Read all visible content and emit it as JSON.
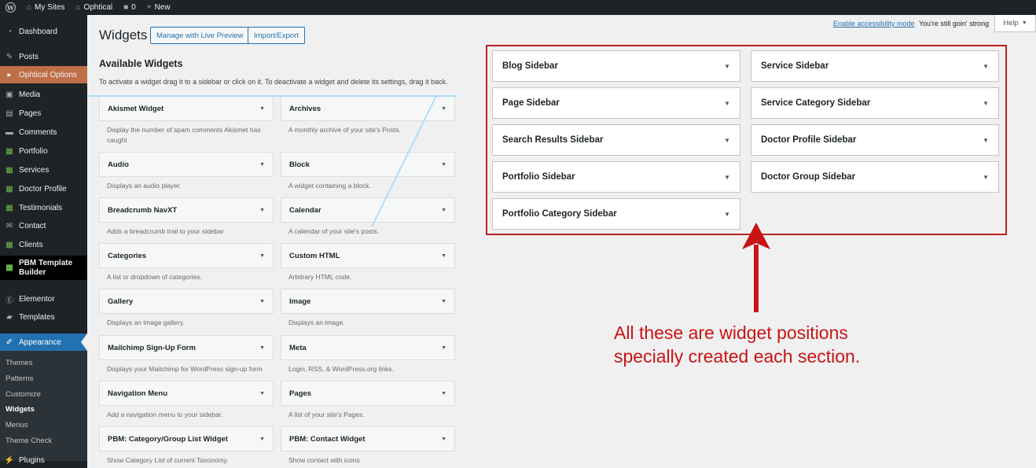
{
  "adminbar": {
    "my_sites": "My Sites",
    "site_name": "Ophtical",
    "comments_count": "0",
    "new_label": "New"
  },
  "menu": {
    "items": [
      {
        "label": "Dashboard",
        "icon": "dashboard-icon"
      },
      {
        "label": "Posts",
        "icon": "pin-icon"
      },
      {
        "label": "Ophtical Options",
        "icon": "caret-right-icon"
      },
      {
        "label": "Media",
        "icon": "media-icon"
      },
      {
        "label": "Pages",
        "icon": "page-icon"
      },
      {
        "label": "Comments",
        "icon": "comment-icon"
      },
      {
        "label": "Portfolio",
        "icon": "grid-icon"
      },
      {
        "label": "Services",
        "icon": "grid-icon"
      },
      {
        "label": "Doctor Profile",
        "icon": "grid-icon"
      },
      {
        "label": "Testimonials",
        "icon": "grid-icon"
      },
      {
        "label": "Contact",
        "icon": "mail-icon"
      },
      {
        "label": "Clients",
        "icon": "grid-icon"
      },
      {
        "label": "PBM Template Builder",
        "icon": "grid-icon"
      },
      {
        "label": "Elementor",
        "icon": "elementor-icon"
      },
      {
        "label": "Templates",
        "icon": "folder-icon"
      },
      {
        "label": "Appearance",
        "icon": "brush-icon"
      },
      {
        "label": "Plugins",
        "icon": "plugin-icon"
      }
    ],
    "submenu": [
      "Themes",
      "Patterns",
      "Customize",
      "Widgets",
      "Menus",
      "Theme Check"
    ]
  },
  "top": {
    "accessibility_link": "Enable accessibility mode",
    "status_text": "You're still goin' strong",
    "help_label": "Help"
  },
  "header": {
    "title": "Widgets",
    "live_preview_button": "Manage with Live Preview",
    "import_export_button": "Import/Export"
  },
  "available": {
    "title": "Available Widgets",
    "description": "To activate a widget drag it to a sidebar or click on it. To deactivate a widget and delete its settings, drag it back.",
    "widgets": [
      {
        "name": "Akismet Widget",
        "desc": "Display the number of spam comments Akismet has caught"
      },
      {
        "name": "Archives",
        "desc": "A monthly archive of your site's Posts."
      },
      {
        "name": "Audio",
        "desc": "Displays an audio player."
      },
      {
        "name": "Block",
        "desc": "A widget containing a block."
      },
      {
        "name": "Breadcrumb NavXT",
        "desc": "Adds a breadcrumb trail to your sidebar"
      },
      {
        "name": "Calendar",
        "desc": "A calendar of your site's posts."
      },
      {
        "name": "Categories",
        "desc": "A list or dropdown of categories."
      },
      {
        "name": "Custom HTML",
        "desc": "Arbitrary HTML code."
      },
      {
        "name": "Gallery",
        "desc": "Displays an image gallery."
      },
      {
        "name": "Image",
        "desc": "Displays an image."
      },
      {
        "name": "Mailchimp Sign-Up Form",
        "desc": "Displays your Mailchimp for WordPress sign-up form"
      },
      {
        "name": "Meta",
        "desc": "Login, RSS, & WordPress.org links."
      },
      {
        "name": "Navigation Menu",
        "desc": "Add a navigation menu to your sidebar."
      },
      {
        "name": "Pages",
        "desc": "A list of your site's Pages."
      },
      {
        "name": "PBM: Category/Group List Widget",
        "desc": "Show Category List of current Taxonomy."
      },
      {
        "name": "PBM: Contact Widget",
        "desc": "Show contact with icons"
      }
    ]
  },
  "sidebars": [
    "Blog Sidebar",
    "Service Sidebar",
    "Page Sidebar",
    "Service Category Sidebar",
    "Search Results Sidebar",
    "Doctor Profile Sidebar",
    "Portfolio Sidebar",
    "Doctor Group Sidebar",
    "Portfolio Category Sidebar"
  ],
  "annotation": {
    "line1": "All these are widget positions",
    "line2": "specially created each section.",
    "color": "#c81414"
  }
}
